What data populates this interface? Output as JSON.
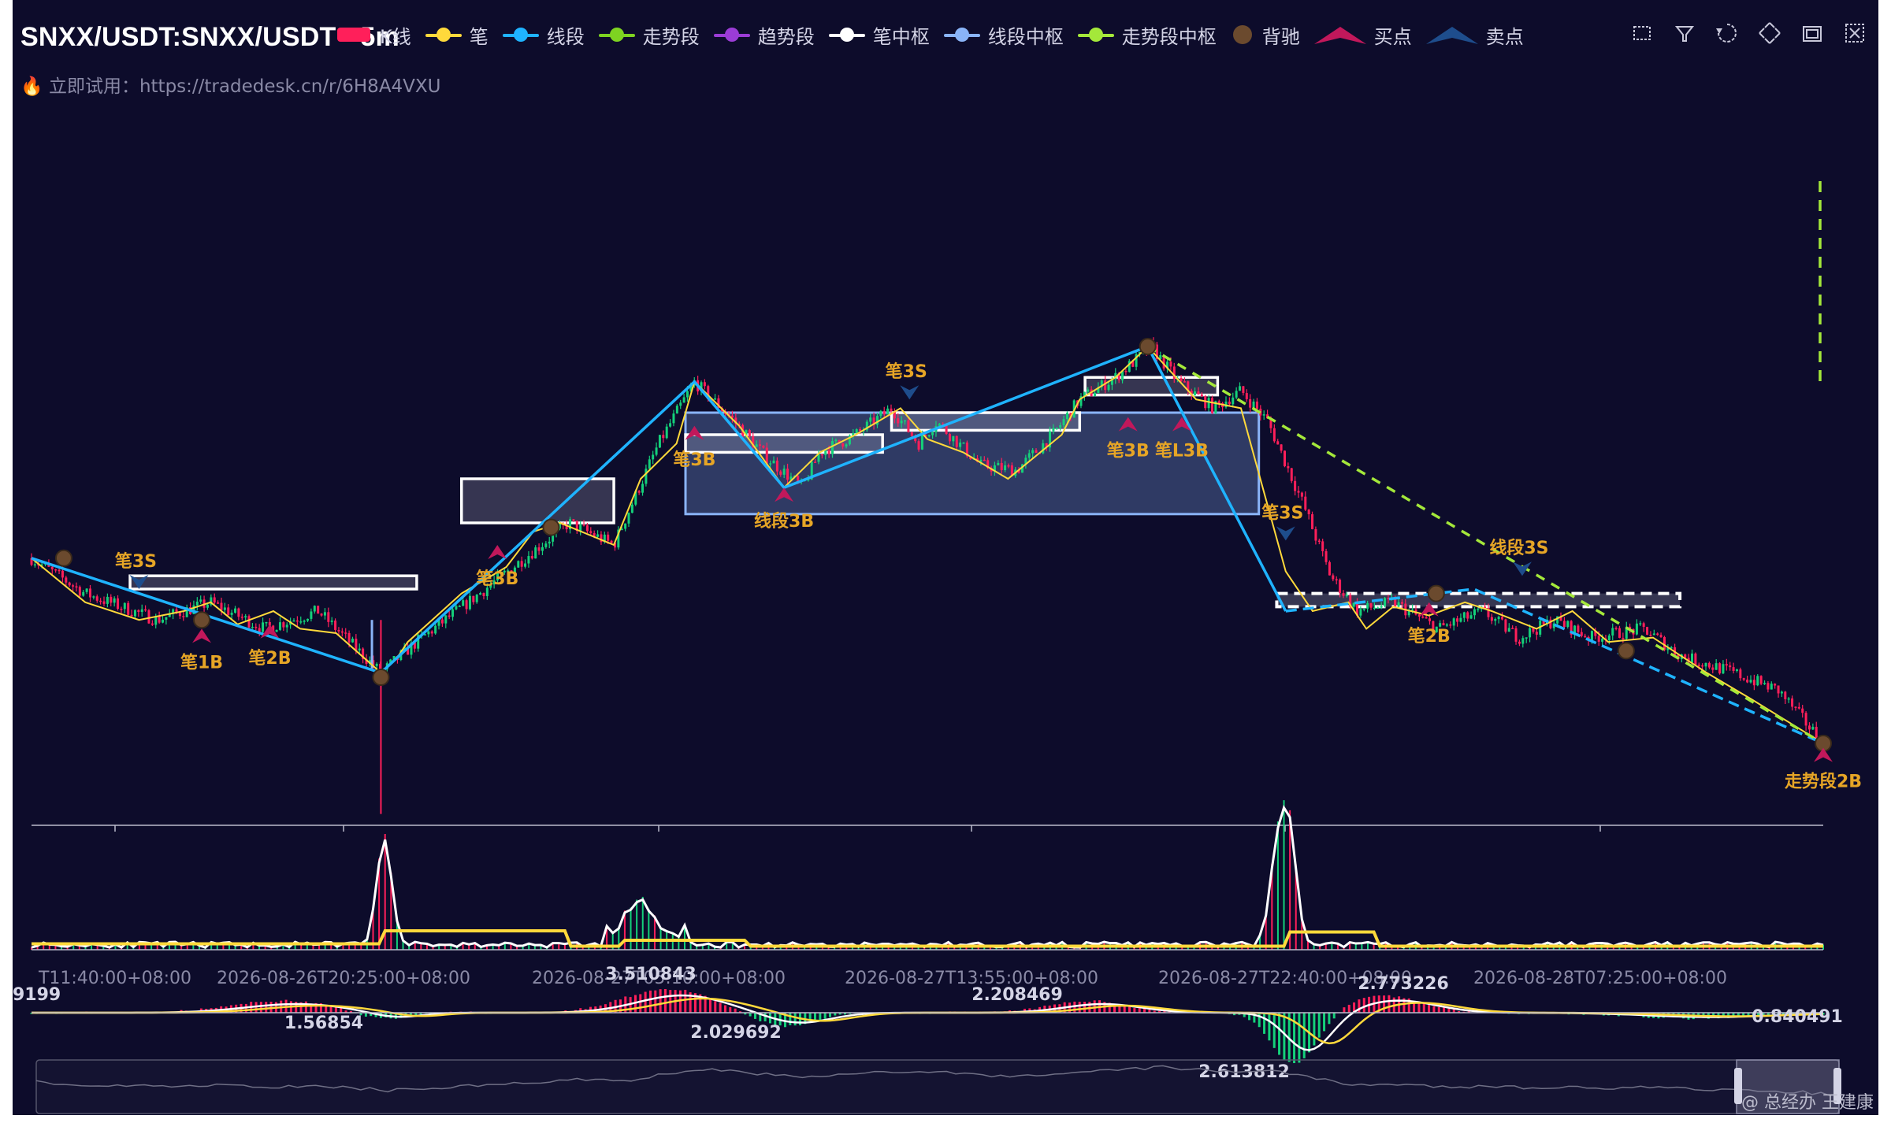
{
  "header": {
    "title": "SNXX/USDT:SNXX/USDT - 5m",
    "promo_prefix": "立即试用：",
    "promo_url": "https://tradedesk.cn/r/6H8A4VXU"
  },
  "legend": [
    {
      "label": "K线",
      "color": "#ff1f5a",
      "kind": "rect"
    },
    {
      "label": "笔",
      "color": "#ffd93b",
      "kind": "line"
    },
    {
      "label": "线段",
      "color": "#1fb3ff",
      "kind": "line"
    },
    {
      "label": "走势段",
      "color": "#7ed321",
      "kind": "line"
    },
    {
      "label": "趋势段",
      "color": "#9b3cd6",
      "kind": "line"
    },
    {
      "label": "笔中枢",
      "color": "#ffffff",
      "kind": "line"
    },
    {
      "label": "线段中枢",
      "color": "#8ab4f8",
      "kind": "line"
    },
    {
      "label": "走势段中枢",
      "color": "#a4e83a",
      "kind": "line"
    },
    {
      "label": "背驰",
      "color": "#6b4a2e",
      "kind": "dot"
    },
    {
      "label": "买点",
      "color": "#c2185b",
      "kind": "up"
    },
    {
      "label": "卖点",
      "color": "#1e4d8c",
      "kind": "down"
    }
  ],
  "toolbar": [
    {
      "name": "zoom-area-icon"
    },
    {
      "name": "zoom-reset-icon"
    },
    {
      "name": "restore-icon"
    },
    {
      "name": "fullscreen-icon"
    },
    {
      "name": "data-view-icon"
    },
    {
      "name": "close-icon"
    }
  ],
  "watermark": "@ 总经办 王建康",
  "chart_data": {
    "type": "candlestick",
    "symbol": "SNXX/USDT:SNXX/USDT",
    "interval": "5m",
    "x_ticks": [
      "T11:40:00+08:00",
      "2026-08-26T20:25:00+08:00",
      "2026-08-27T05:10:00+08:00",
      "2026-08-27T13:55:00+08:00",
      "2026-08-27T22:40:00+08:00",
      "2026-08-28T07:25:00+08:00"
    ],
    "price_path": [
      [
        0,
        0.52
      ],
      [
        30,
        0.44
      ],
      [
        70,
        0.38
      ],
      [
        100,
        0.42
      ],
      [
        130,
        0.36
      ],
      [
        160,
        0.4
      ],
      [
        195,
        0.26
      ],
      [
        215,
        0.33
      ],
      [
        250,
        0.44
      ],
      [
        275,
        0.52
      ],
      [
        300,
        0.6
      ],
      [
        325,
        0.55
      ],
      [
        350,
        0.78
      ],
      [
        370,
        0.92
      ],
      [
        390,
        0.84
      ],
      [
        410,
        0.75
      ],
      [
        430,
        0.68
      ],
      [
        440,
        0.76
      ],
      [
        460,
        0.8
      ],
      [
        480,
        0.86
      ],
      [
        495,
        0.78
      ],
      [
        505,
        0.83
      ],
      [
        530,
        0.73
      ],
      [
        550,
        0.72
      ],
      [
        570,
        0.8
      ],
      [
        585,
        0.88
      ],
      [
        605,
        0.93
      ],
      [
        625,
        1.0
      ],
      [
        640,
        0.92
      ],
      [
        660,
        0.86
      ],
      [
        675,
        0.9
      ],
      [
        690,
        0.83
      ],
      [
        710,
        0.64
      ],
      [
        725,
        0.48
      ],
      [
        740,
        0.4
      ],
      [
        760,
        0.42
      ],
      [
        785,
        0.36
      ],
      [
        810,
        0.4
      ],
      [
        830,
        0.34
      ],
      [
        850,
        0.38
      ],
      [
        870,
        0.34
      ],
      [
        900,
        0.36
      ],
      [
        920,
        0.3
      ],
      [
        950,
        0.26
      ],
      [
        975,
        0.22
      ],
      [
        1000,
        0.1
      ]
    ],
    "bi_pen": [
      [
        0,
        0.52
      ],
      [
        30,
        0.42
      ],
      [
        60,
        0.38
      ],
      [
        85,
        0.4
      ],
      [
        100,
        0.42
      ],
      [
        115,
        0.37
      ],
      [
        135,
        0.4
      ],
      [
        150,
        0.36
      ],
      [
        170,
        0.35
      ],
      [
        195,
        0.26
      ],
      [
        205,
        0.3
      ],
      [
        210,
        0.33
      ],
      [
        240,
        0.44
      ],
      [
        265,
        0.5
      ],
      [
        280,
        0.58
      ],
      [
        295,
        0.6
      ],
      [
        325,
        0.55
      ],
      [
        340,
        0.7
      ],
      [
        360,
        0.78
      ],
      [
        370,
        0.92
      ],
      [
        395,
        0.82
      ],
      [
        420,
        0.68
      ],
      [
        440,
        0.76
      ],
      [
        460,
        0.8
      ],
      [
        485,
        0.86
      ],
      [
        500,
        0.79
      ],
      [
        520,
        0.76
      ],
      [
        545,
        0.7
      ],
      [
        575,
        0.8
      ],
      [
        585,
        0.88
      ],
      [
        605,
        0.93
      ],
      [
        623,
        1.0
      ],
      [
        650,
        0.88
      ],
      [
        675,
        0.86
      ],
      [
        700,
        0.49
      ],
      [
        715,
        0.4
      ],
      [
        735,
        0.42
      ],
      [
        745,
        0.36
      ],
      [
        760,
        0.41
      ],
      [
        780,
        0.39
      ],
      [
        800,
        0.42
      ],
      [
        815,
        0.4
      ],
      [
        840,
        0.36
      ],
      [
        860,
        0.4
      ],
      [
        880,
        0.33
      ],
      [
        905,
        0.34
      ],
      [
        935,
        0.26
      ],
      [
        960,
        0.2
      ],
      [
        1000,
        0.1
      ]
    ],
    "segments": [
      [
        0,
        0.52
      ],
      [
        195,
        0.26
      ],
      [
        370,
        0.92
      ],
      [
        420,
        0.68
      ],
      [
        623,
        1.0
      ],
      [
        700,
        0.4
      ],
      [
        805,
        0.45
      ],
      [
        1000,
        0.1
      ]
    ],
    "trend_segment": [
      [
        623,
        1.0
      ],
      [
        1000,
        0.1
      ]
    ],
    "bi_pivots": [
      [
        [
          55,
          0.45
        ],
        [
          215,
          0.48
        ]
      ],
      [
        [
          240,
          0.6
        ],
        [
          325,
          0.7
        ]
      ],
      [
        [
          365,
          0.76
        ],
        [
          475,
          0.8
        ]
      ],
      [
        [
          480,
          0.81
        ],
        [
          585,
          0.85
        ]
      ],
      [
        [
          588,
          0.89
        ],
        [
          662,
          0.93
        ]
      ]
    ],
    "segment_pivots": [
      [
        [
          365,
          0.62
        ],
        [
          685,
          0.85
        ]
      ]
    ],
    "trend_pivots": [
      [
        [
          695,
          0.41
        ],
        [
          920,
          0.44
        ]
      ]
    ],
    "divergence_points": [
      [
        18,
        0.52
      ],
      [
        95,
        0.38
      ],
      [
        195,
        0.25
      ],
      [
        290,
        0.59
      ],
      [
        623,
        1.0
      ],
      [
        784,
        0.44
      ],
      [
        890,
        0.31
      ],
      [
        1000,
        0.1
      ]
    ],
    "buy_points": [
      {
        "x": 95,
        "y": 0.36,
        "label": "笔1B"
      },
      {
        "x": 133,
        "y": 0.37,
        "label": "笔2B"
      },
      {
        "x": 260,
        "y": 0.55,
        "label": "笔3B"
      },
      {
        "x": 370,
        "y": 0.82,
        "label": "笔3B"
      },
      {
        "x": 420,
        "y": 0.68,
        "label": "线段3B"
      },
      {
        "x": 612,
        "y": 0.84,
        "label": "笔3B"
      },
      {
        "x": 642,
        "y": 0.84,
        "label": "笔L3B"
      },
      {
        "x": 780,
        "y": 0.42,
        "label": "笔2B"
      },
      {
        "x": 1000,
        "y": 0.09,
        "label": "走势段2B"
      }
    ],
    "sell_points": [
      {
        "x": 60,
        "y": 0.45,
        "label": "笔3S"
      },
      {
        "x": 490,
        "y": 0.88,
        "label": "笔3S"
      },
      {
        "x": 700,
        "y": 0.56,
        "label": "笔3S"
      },
      {
        "x": 832,
        "y": 0.48,
        "label": "线段3S"
      }
    ],
    "macd_value_labels": [
      "9199",
      "1.56854",
      "3.510843",
      "2.029692",
      "2.208469",
      "2.773226",
      "2.613812",
      "0.840491"
    ],
    "volume_spikes": [
      [
        197,
        0.92
      ],
      [
        335,
        0.18
      ],
      [
        342,
        0.22
      ],
      [
        695,
        0.74
      ],
      [
        702,
        0.95
      ]
    ]
  }
}
